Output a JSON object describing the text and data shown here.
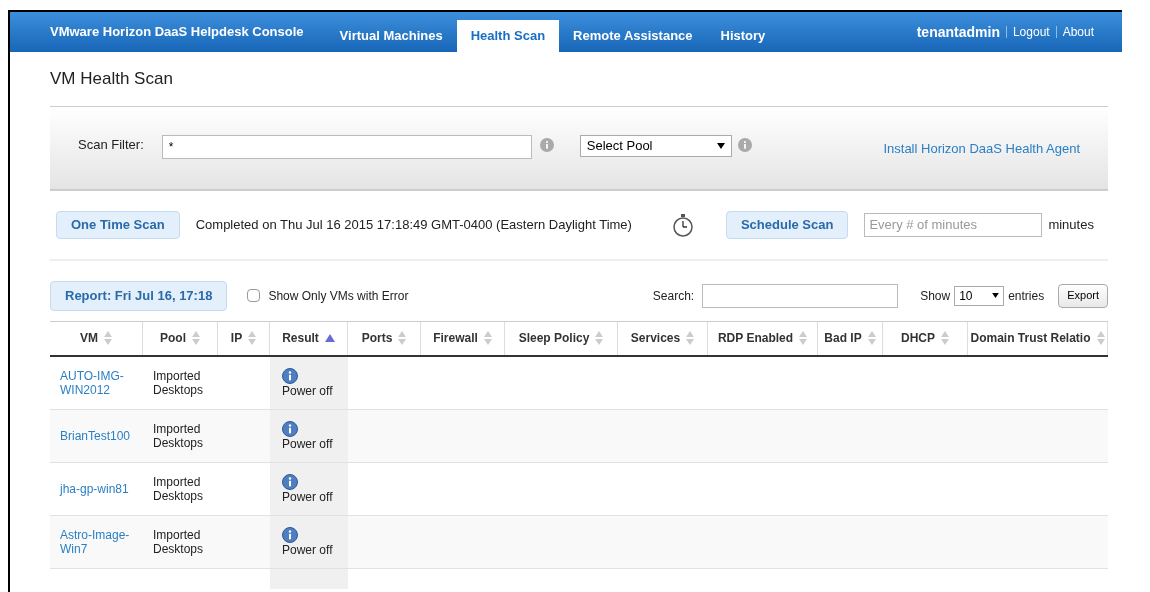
{
  "header": {
    "title": "VMware Horizon DaaS Helpdesk Console",
    "tabs": [
      {
        "label": "Virtual Machines",
        "selected": false
      },
      {
        "label": "Health Scan",
        "selected": true
      },
      {
        "label": "Remote Assistance",
        "selected": false
      },
      {
        "label": "History",
        "selected": false
      }
    ],
    "user": "tenantadmin",
    "links": [
      "Logout",
      "About"
    ]
  },
  "page_title": "VM Health Scan",
  "filter": {
    "label": "Scan Filter:",
    "value": "*",
    "pool_select": "Select Pool",
    "install_link": "Install Horizon DaaS Health Agent"
  },
  "scan": {
    "one_time_button": "One Time Scan",
    "status": "Completed on Thu Jul 16 2015 17:18:49 GMT-0400 (Eastern Daylight Time)",
    "schedule_button": "Schedule Scan",
    "interval_placeholder": "Every # of minutes",
    "interval_unit": "minutes"
  },
  "report": {
    "button": "Report: Fri Jul 16, 17:18",
    "error_only": {
      "label": "Show Only VMs with Error",
      "checked": false
    },
    "search_label": "Search:",
    "show_label": "Show",
    "page_size": "10",
    "entries_label": "entries",
    "export_button": "Export"
  },
  "table": {
    "columns": [
      {
        "label": "VM",
        "sorted": false
      },
      {
        "label": "Pool",
        "sorted": false
      },
      {
        "label": "IP",
        "sorted": false
      },
      {
        "label": "Result",
        "sorted": true
      },
      {
        "label": "Ports",
        "sorted": false
      },
      {
        "label": "Firewall",
        "sorted": false
      },
      {
        "label": "Sleep Policy",
        "sorted": false
      },
      {
        "label": "Services",
        "sorted": false
      },
      {
        "label": "RDP Enabled",
        "sorted": false
      },
      {
        "label": "Bad IP",
        "sorted": false
      },
      {
        "label": "DHCP",
        "sorted": false
      },
      {
        "label": "Domain Trust Relatio",
        "sorted": false
      }
    ],
    "rows": [
      {
        "vm": "AUTO-IMG-WIN2012",
        "pool": "Imported Desktops",
        "result": "Power off"
      },
      {
        "vm": "BrianTest100",
        "pool": "Imported Desktops",
        "result": "Power off"
      },
      {
        "vm": "jha-gp-win81",
        "pool": "Imported Desktops",
        "result": "Power off"
      },
      {
        "vm": "Astro-Image-Win7",
        "pool": "Imported Desktops",
        "result": "Power off"
      }
    ]
  }
}
